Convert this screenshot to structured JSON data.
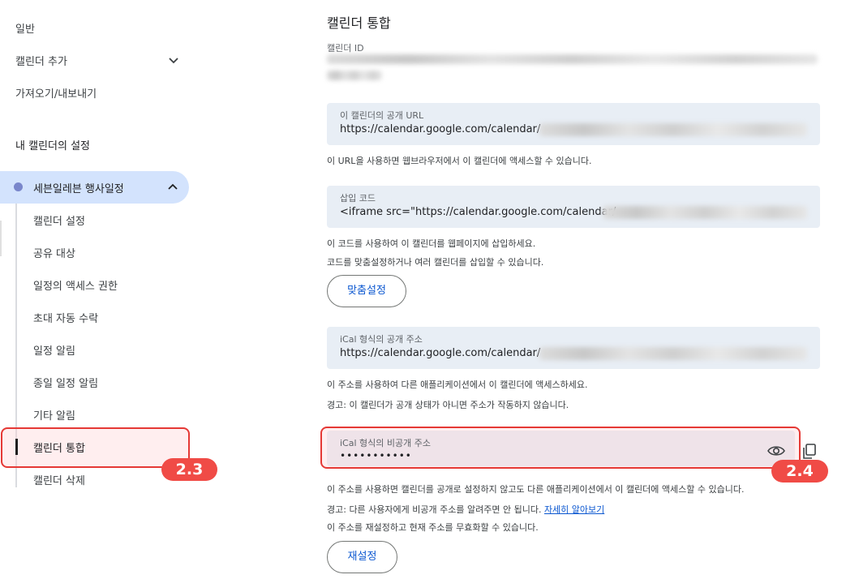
{
  "sidebar": {
    "top_items": [
      "일반",
      "캘린더 추가",
      "가져오기/내보내기"
    ],
    "section_title": "내 캘린더의 설정",
    "calendar_name": "세븐일레븐 행사일정",
    "calendar_color": "#7986cb",
    "sub_items": [
      "캘린더 설정",
      "공유 대상",
      "일정의 액세스 권한",
      "초대 자동 수락",
      "일정 알림",
      "종일 일정 알림",
      "기타 알림",
      "캘린더 통합",
      "캘린더 삭제"
    ],
    "active_sub_item": "캘린더 통합",
    "annotation_badge": "2.3"
  },
  "main": {
    "title": "캘린더 통합",
    "calendar_id_label": "캘린더 ID",
    "public_url": {
      "label": "이 캘린더의 공개 URL",
      "value": "https://calendar.google.com/calendar/",
      "help": "이 URL을 사용하면 웹브라우저에서 이 캘린더에 액세스할 수 있습니다."
    },
    "embed_code": {
      "label": "삽입 코드",
      "value": "<iframe src=\"https://calendar.google.com/calendar/",
      "help1": "이 코드를 사용하여 이 캘린더를 웹페이지에 삽입하세요.",
      "help2": "코드를 맞춤설정하거나 여러 캘린더를 삽입할 수 있습니다.",
      "customize_button": "맞춤설정"
    },
    "ical_public": {
      "label": "iCal 형식의 공개 주소",
      "value": "https://calendar.google.com/calendar/",
      "help1": "이 주소를 사용하여 다른 애플리케이션에서 이 캘린더에 액세스하세요.",
      "help2": "경고: 이 캘린더가 공개 상태가 아니면 주소가 작동하지 않습니다."
    },
    "ical_private": {
      "label": "iCal 형식의 비공개 주소",
      "value": "•••••••••••",
      "annotation_badge": "2.4",
      "help1": "이 주소를 사용하면 캘린더를 공개로 설정하지 않고도 다른 애플리케이션에서 이 캘린더에 액세스할 수 있습니다.",
      "warning": "경고: 다른 사용자에게 비공개 주소를 알려주면 안 됩니다.",
      "learn_more": "자세히 알아보기",
      "help3": "이 주소를 재설정하고 현재 주소를 무효화할 수 있습니다.",
      "reset_button": "재설정"
    }
  },
  "icons": [
    "chevron-down-icon",
    "chevron-up-icon",
    "eye-icon",
    "copy-icon"
  ],
  "colors": {
    "highlight_border": "#e53935",
    "badge": "#f04b46",
    "field_bg": "#e8eef5",
    "link": "#0b57d0"
  }
}
